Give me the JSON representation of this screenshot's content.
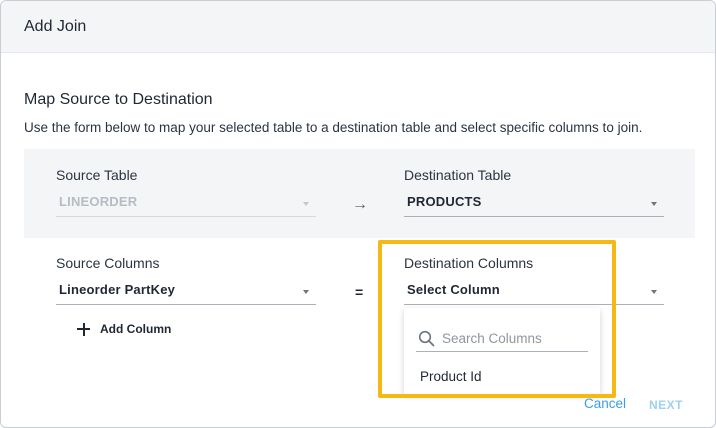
{
  "dialog": {
    "title": "Add Join"
  },
  "section": {
    "title": "Map Source to Destination",
    "description": "Use the form below to map your selected table to a destination table and select specific columns to join."
  },
  "tables": {
    "source_label": "Source Table",
    "source_value": "LINEORDER",
    "arrow": "→",
    "destination_label": "Destination Table",
    "destination_value": "PRODUCTS"
  },
  "columns": {
    "source_label": "Source Columns",
    "source_value": "Lineorder PartKey",
    "equals": "=",
    "destination_label": "Destination Columns",
    "destination_value": "Select Column",
    "add_column_label": "Add Column"
  },
  "dropdown": {
    "search_placeholder": "Search Columns",
    "options": [
      {
        "label": "Product Id"
      }
    ]
  },
  "footer": {
    "cancel_label": "Cancel",
    "next_label": "NEXT"
  },
  "colors": {
    "highlight": "#f6b814",
    "link": "#3a9ee6",
    "disabled_link": "#9fd0f0"
  },
  "icons": [
    "chevron-down-icon",
    "arrow-right-icon",
    "plus-icon",
    "search-icon"
  ]
}
